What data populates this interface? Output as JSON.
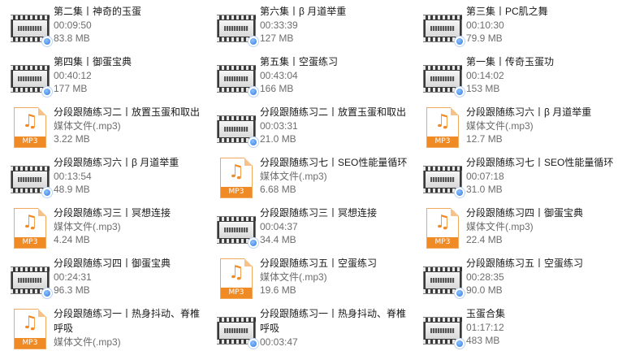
{
  "files": [
    {
      "name": "第二集丨神奇的玉蛋",
      "type": "video",
      "duration": "00:09:50",
      "size": "83.8 MB"
    },
    {
      "name": "第六集丨β 月道举重",
      "type": "video",
      "duration": "00:33:39",
      "size": "127 MB"
    },
    {
      "name": "第三集丨PC肌之舞",
      "type": "video",
      "duration": "00:10:30",
      "size": "79.9 MB"
    },
    {
      "name": "第四集丨御蛋宝典",
      "type": "video",
      "duration": "00:40:12",
      "size": "177 MB"
    },
    {
      "name": "第五集丨空蛋练习",
      "type": "video",
      "duration": "00:43:04",
      "size": "166 MB"
    },
    {
      "name": "第一集丨传奇玉蛋功",
      "type": "video",
      "duration": "00:14:02",
      "size": "153 MB"
    },
    {
      "name": "分段跟随练习二丨放置玉蛋和取出",
      "type": "audio",
      "kind": "媒体文件(.mp3)",
      "size": "3.22 MB"
    },
    {
      "name": "分段跟随练习二丨放置玉蛋和取出",
      "type": "video",
      "duration": "00:03:31",
      "size": "21.0 MB"
    },
    {
      "name": "分段跟随练习六丨β 月道举重",
      "type": "audio",
      "kind": "媒体文件(.mp3)",
      "size": "12.7 MB"
    },
    {
      "name": "分段跟随练习六丨β 月道举重",
      "type": "video",
      "duration": "00:13:54",
      "size": "48.9 MB"
    },
    {
      "name": "分段跟随练习七丨SEO性能量循环",
      "type": "audio",
      "kind": "媒体文件(.mp3)",
      "size": "6.68 MB"
    },
    {
      "name": "分段跟随练习七丨SEO性能量循环",
      "type": "video",
      "duration": "00:07:18",
      "size": "31.0 MB"
    },
    {
      "name": "分段跟随练习三丨冥想连接",
      "type": "audio",
      "kind": "媒体文件(.mp3)",
      "size": "4.24 MB"
    },
    {
      "name": "分段跟随练习三丨冥想连接",
      "type": "video",
      "duration": "00:04:37",
      "size": "34.4 MB"
    },
    {
      "name": "分段跟随练习四丨御蛋宝典",
      "type": "audio",
      "kind": "媒体文件(.mp3)",
      "size": "22.4 MB"
    },
    {
      "name": "分段跟随练习四丨御蛋宝典",
      "type": "video",
      "duration": "00:24:31",
      "size": "96.3 MB"
    },
    {
      "name": "分段跟随练习五丨空蛋练习",
      "type": "audio",
      "kind": "媒体文件(.mp3)",
      "size": "19.6 MB"
    },
    {
      "name": "分段跟随练习五丨空蛋练习",
      "type": "video",
      "duration": "00:28:35",
      "size": "90.0 MB"
    },
    {
      "name": "分段跟随练习一丨热身抖动、脊椎呼吸",
      "type": "audio",
      "kind": "媒体文件(.mp3)",
      "size": ""
    },
    {
      "name": "分段跟随练习一丨热身抖动、脊椎呼吸",
      "type": "video",
      "duration": "00:03:47",
      "size": ""
    },
    {
      "name": "玉蛋合集",
      "type": "video",
      "duration": "01:17:12",
      "size": "483 MB"
    }
  ],
  "icons": {
    "video": "video-thumbnail-icon",
    "audio": "mp3-audio-icon"
  },
  "audio_ext_label": "MP3",
  "accent_color": "#f08a24"
}
